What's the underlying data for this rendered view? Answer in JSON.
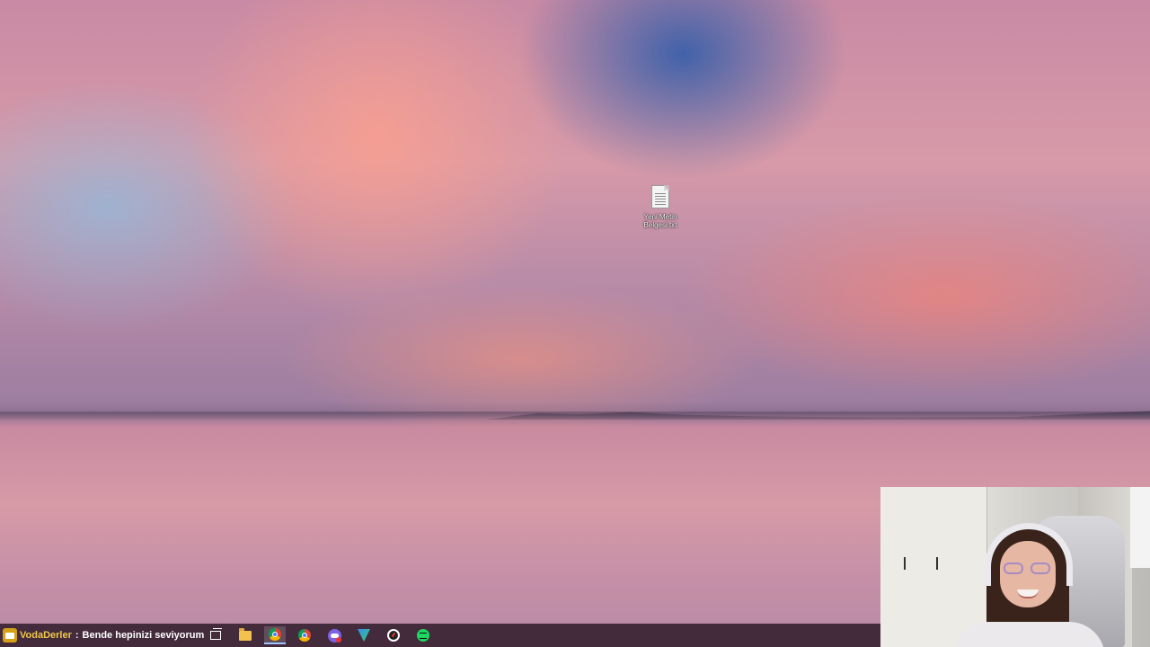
{
  "desktop": {
    "icons": [
      {
        "label": "Yeni Metin Belgesi.txt",
        "icon": "text-file-icon"
      }
    ]
  },
  "chat_overlay": {
    "username": "VodaDerler",
    "separator": ":",
    "message": "Bende hepinizi seviyorum"
  },
  "taskbar": {
    "apps": [
      {
        "name": "task-view",
        "icon": "task-view-icon",
        "active": false
      },
      {
        "name": "file-explorer",
        "icon": "folder-icon",
        "active": false
      },
      {
        "name": "chrome",
        "icon": "chrome-icon",
        "active": true
      },
      {
        "name": "chrome-2",
        "icon": "chrome-icon",
        "active": false
      },
      {
        "name": "discord",
        "icon": "discord-icon",
        "active": false
      },
      {
        "name": "security-app",
        "icon": "shield-icon",
        "active": false
      },
      {
        "name": "performance-monitor",
        "icon": "gauge-icon",
        "active": false
      },
      {
        "name": "spotify",
        "icon": "spotify-icon",
        "active": false
      }
    ]
  },
  "webcam": {
    "present": true
  },
  "colors": {
    "taskbar_bg": "#321e2d",
    "chat_username": "#f0c84a",
    "active_indicator": "#9fc3ff"
  }
}
